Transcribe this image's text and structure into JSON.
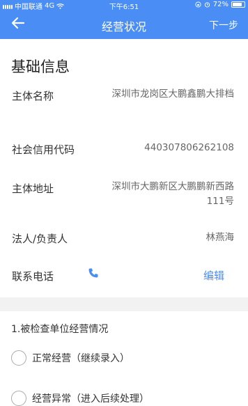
{
  "status_bar": {
    "carrier": "中国联通",
    "network": "4G",
    "time": "下午6:51",
    "battery": "72%"
  },
  "header": {
    "back_icon": "arrow-left-icon",
    "title": "经营状况",
    "next_label": "下一步"
  },
  "basic_info": {
    "title": "基础信息",
    "subject_name_label": "主体名称",
    "subject_name_value": "深圳市龙岗区大鹏鑫鹏大排档",
    "credit_code_label": "社会信用代码",
    "credit_code_value": "440307806262108",
    "address_label": "主体地址",
    "address_value": "深圳市大鹏新区大鹏鹏新西路111号",
    "legal_person_label": "法人/负责人",
    "legal_person_value": "林燕海",
    "phone_label": "联系电话",
    "phone_icon": "phone-icon",
    "edit_label": "编辑"
  },
  "inspection": {
    "question": "1.被检查单位经营情况",
    "options": [
      {
        "label": "正常经营（继续录入）",
        "selected": false
      },
      {
        "label": "经营异常（进入后续处理）",
        "selected": false
      }
    ]
  },
  "colors": {
    "accent": "#4a8df5",
    "band": "#f2f2f2"
  }
}
